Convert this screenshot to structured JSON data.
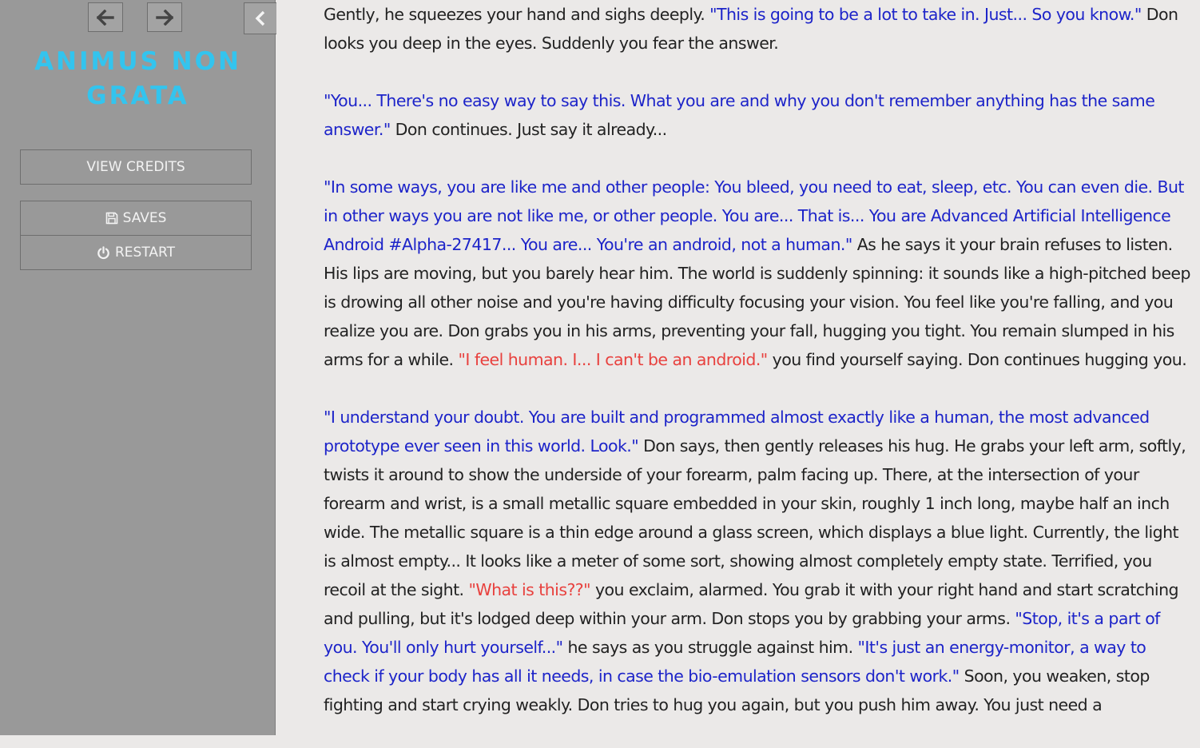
{
  "sidebar": {
    "back_icon": "arrow-left-icon",
    "forward_icon": "arrow-right-icon",
    "toggle_icon": "chevron-left-icon",
    "title_line1": "ANIMUS NON",
    "title_line2": "GRATA",
    "credits_label": "VIEW CREDITS",
    "saves_label": "SAVES",
    "restart_label": "RESTART",
    "colors": {
      "background": "#999999",
      "title": "#33c4ee"
    }
  },
  "passage": {
    "colors": {
      "narration": "#222222",
      "don_speech": "#1d24c9",
      "player_speech": "#e8413e"
    },
    "p1": {
      "s1": "Gently, he squeezes your hand and sighs deeply. ",
      "d1": "\"This is going to be a lot to take in. Just... So you know.\"",
      "s2": " Don looks you deep in the eyes. Suddenly you fear the answer."
    },
    "p2": {
      "d1": "\"You... There's no easy way to say this. What you are and why you don't remember anything has the same answer.\"",
      "s1": " Don continues. Just say it already..."
    },
    "p3": {
      "d1": "\"In some ways, you are like me and other people: You bleed, you need to eat, sleep, etc. You can even die. But in other ways you are not like me, or other people. You are... That is... You are Advanced Artificial Intelligence Android #Alpha-27417... You are... You're an android, not a human.\"",
      "s1": " As he says it your brain refuses to listen. His lips are moving, but you barely hear him. The world is suddenly spinning: it sounds like a high-pitched beep is drowing all other noise and you're having difficulty focusing your vision. You feel like you're falling, and you realize you are. Don grabs you in his arms, preventing your fall, hugging you tight. You remain slumped in his arms for a while. ",
      "y1": "\"I feel human. I... I can't be an android.\"",
      "s2": " you find yourself saying. Don continues hugging you."
    },
    "p4": {
      "d1": "\"I understand your doubt. You are built and programmed almost exactly like a human, the most advanced prototype ever seen in this world. Look.\"",
      "s1": " Don says, then gently releases his hug. He grabs your left arm, softly, twists it around to show the underside of your forearm, palm facing up. There, at the intersection of your forearm and wrist, is a small metallic square embedded in your skin, roughly 1 inch long, maybe half an inch wide. The metallic square is a thin edge around a glass screen, which displays a blue light. Currently, the light is almost empty... It looks like a meter of some sort, showing almost completely empty state. Terrified, you recoil at the sight. ",
      "y1": "\"What is this??\"",
      "s2": " you exclaim, alarmed. You grab it with your right hand and start scratching and pulling, but it's lodged deep within your arm. Don stops you by grabbing your arms. ",
      "d2": "\"Stop, it's a part of you. You'll only hurt yourself...\"",
      "s3": " he says as you struggle against him. ",
      "d3": "\"It's just an energy-monitor, a way to check if your body has all it needs, in case the bio-emulation sensors don't work.\"",
      "s4": " Soon, you weaken, stop fighting and start crying weakly. Don tries to hug you again, but you push him away. You just need a"
    }
  }
}
